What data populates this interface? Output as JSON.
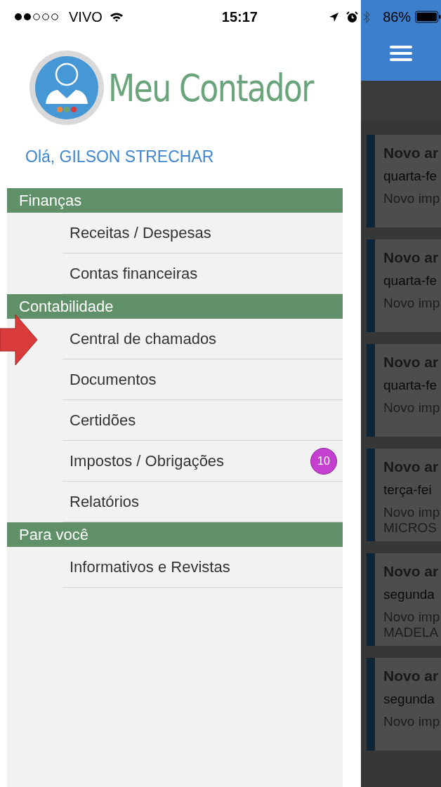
{
  "status_bar": {
    "carrier": "VIVO",
    "time": "15:17",
    "battery": "86%"
  },
  "drawer": {
    "app_name": "Meu Contador",
    "greeting": "Olá, GILSON STRECHAR",
    "sections": [
      {
        "title": "Finanças",
        "items": [
          {
            "label": "Receitas / Despesas"
          },
          {
            "label": "Contas financeiras"
          }
        ]
      },
      {
        "title": "Contabilidade",
        "items": [
          {
            "label": "Central de chamados",
            "pointed": true
          },
          {
            "label": "Documentos"
          },
          {
            "label": "Certidões"
          },
          {
            "label": "Impostos / Obrigações",
            "badge": "10"
          },
          {
            "label": "Relatórios"
          }
        ]
      },
      {
        "title": "Para você",
        "items": [
          {
            "label": "Informativos e Revistas"
          }
        ]
      }
    ]
  },
  "feed": {
    "cards": [
      {
        "title": "Novo ar",
        "date": "quarta-fe",
        "lines": [
          "Novo imp"
        ]
      },
      {
        "title": "Novo ar",
        "date": "quarta-fe",
        "lines": [
          "Novo imp"
        ]
      },
      {
        "title": "Novo ar",
        "date": "quarta-fe",
        "lines": [
          "Novo imp"
        ]
      },
      {
        "title": "Novo ar",
        "date": "terça-fei",
        "lines": [
          "Novo imp",
          "MICROS"
        ]
      },
      {
        "title": "Novo ar",
        "date": "segunda",
        "lines": [
          "Novo imp",
          "MADELA"
        ]
      },
      {
        "title": "Novo ar",
        "date": "segunda",
        "lines": [
          "Novo imp"
        ]
      }
    ]
  }
}
